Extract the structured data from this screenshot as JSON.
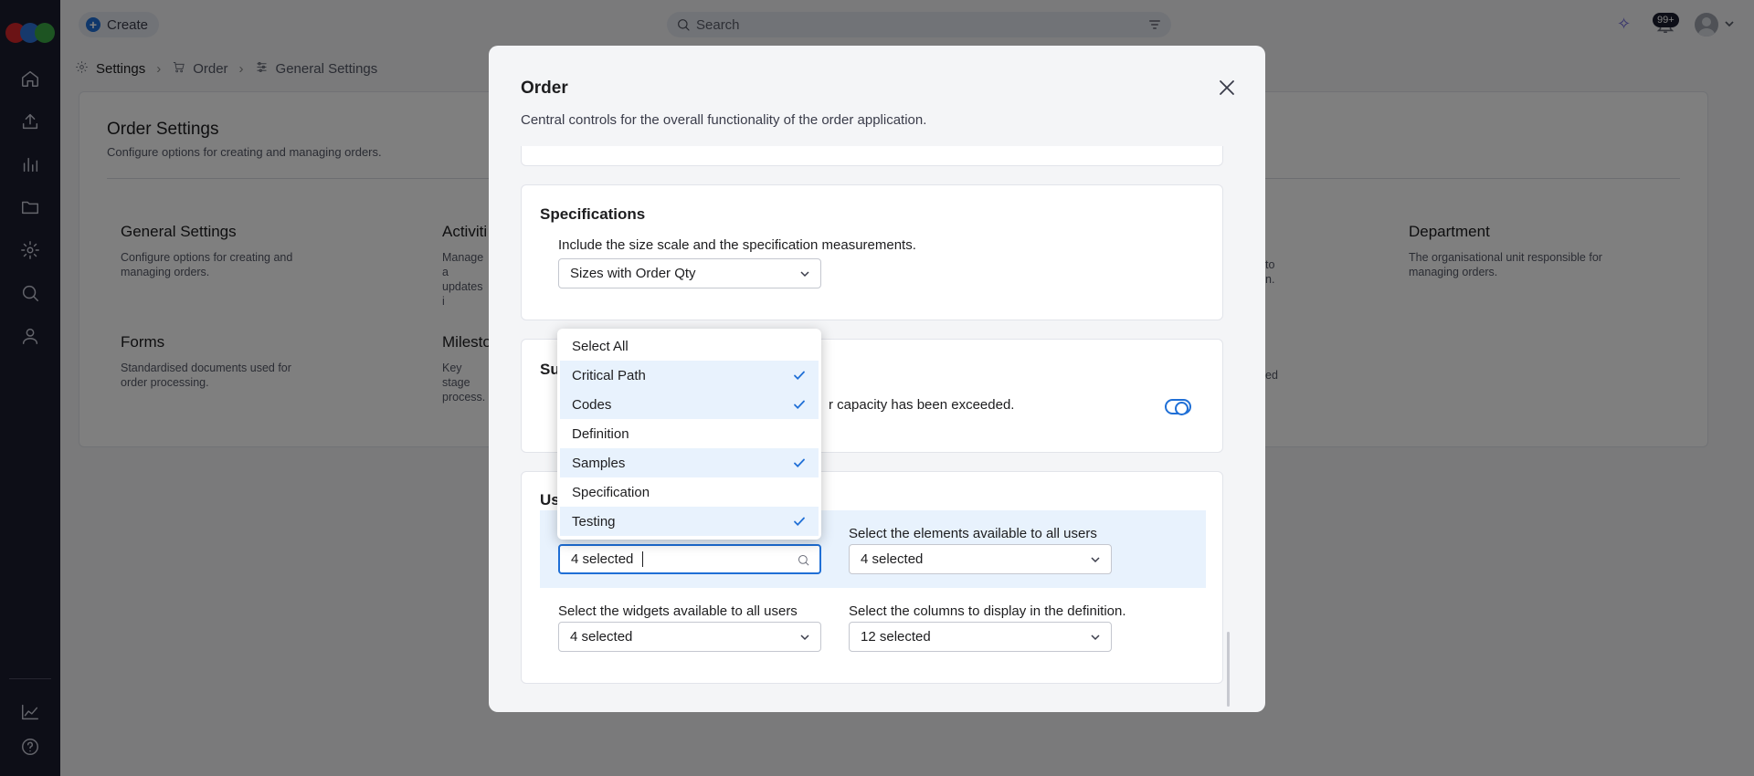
{
  "topbar": {
    "create_label": "Create",
    "search_placeholder": "Search",
    "notification_count": "99+"
  },
  "breadcrumb": {
    "items": [
      "Settings",
      "Order",
      "General Settings"
    ]
  },
  "page": {
    "title": "Order Settings",
    "subtitle": "Configure options for creating and managing orders.",
    "tiles": [
      {
        "title": "General Settings",
        "desc": "Configure options for creating and managing orders."
      },
      {
        "title": "Activiti",
        "desc": "Manage a updates i"
      },
      {
        "title": "Department",
        "desc": "The organisational unit responsible for managing orders."
      },
      {
        "title": "Forms",
        "desc": "Standardised documents used for order processing."
      },
      {
        "title": "Milesto",
        "desc": "Key stage process."
      }
    ],
    "hidden_fragments": [
      "to",
      "n.",
      "ed"
    ]
  },
  "modal": {
    "title": "Order",
    "description": "Central controls for the overall functionality of the order application.",
    "specifications": {
      "title": "Specifications",
      "label": "Include the size scale and the specification measurements.",
      "value": "Sizes with Order Qty"
    },
    "supplier": {
      "title_fragment": "Su",
      "label_fragment": "r capacity has been exceeded.",
      "toggle_on": true
    },
    "users": {
      "title_fragment": "Us",
      "active_select_value": "4 selected",
      "elements_label": "Select the elements available to all users",
      "elements_value": "4 selected",
      "widgets_label": "Select the widgets available to all users",
      "widgets_value": "4 selected",
      "columns_label": "Select the columns to display in the definition.",
      "columns_value": "12 selected"
    }
  },
  "dropdown": {
    "items": [
      {
        "label": "Select All",
        "selected": false
      },
      {
        "label": "Critical Path",
        "selected": true
      },
      {
        "label": "Codes",
        "selected": true
      },
      {
        "label": "Definition",
        "selected": false
      },
      {
        "label": "Samples",
        "selected": true
      },
      {
        "label": "Specification",
        "selected": false
      },
      {
        "label": "Testing",
        "selected": true
      }
    ]
  },
  "colors": {
    "accent": "#1f6fd6",
    "sidebar_bg": "#1b1c2e",
    "selected_row": "#e8f2fd",
    "logo": [
      "#d6262b",
      "#2d73d8",
      "#3aa845"
    ]
  }
}
